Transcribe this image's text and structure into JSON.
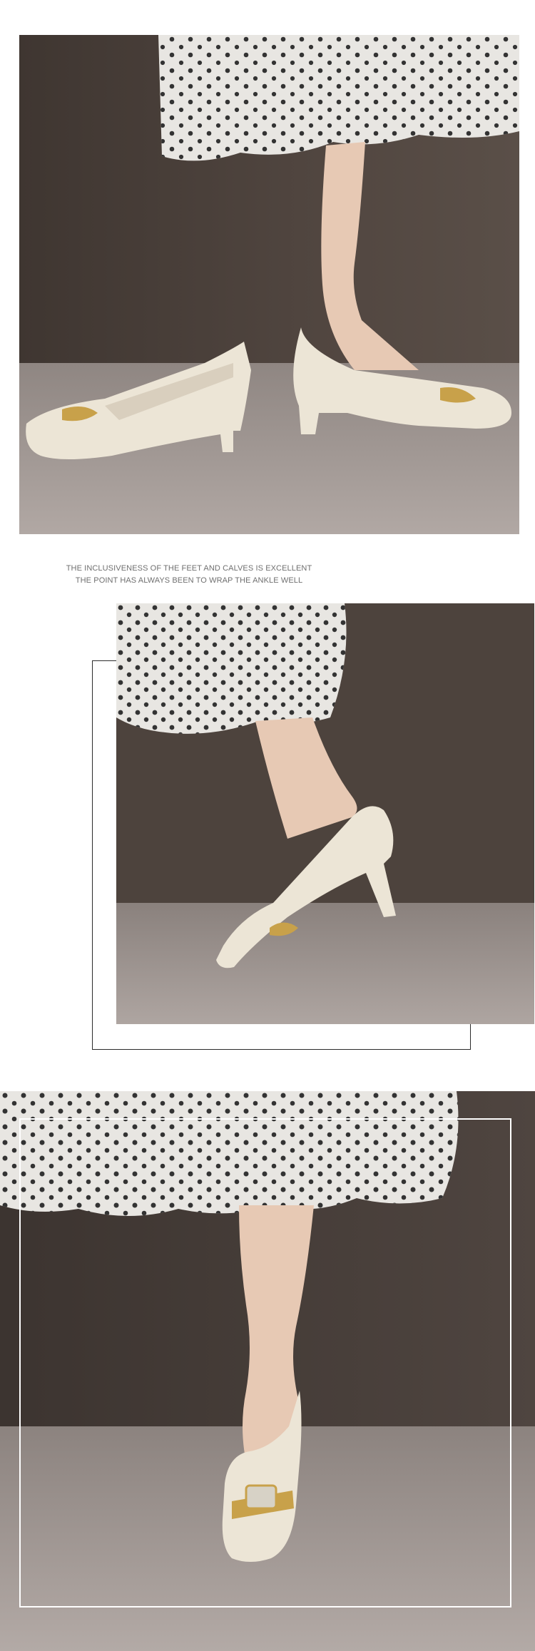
{
  "caption": {
    "line1": "THE INCLUSIVENESS OF THE FEET AND CALVES IS EXCELLENT",
    "line2": "THE POINT HAS ALWAYS BEEN TO WRAP THE ANKLE WELL"
  },
  "colors": {
    "background": "#ffffff",
    "caption_text": "#6f6f6f",
    "frame_dark": "#2b2b2b",
    "frame_light": "#ffffff",
    "wall": "#4a403a",
    "carpet": "#a39a96",
    "shoe": "#ece5d6",
    "skirt": "#e8e6e2",
    "polka_dot": "#1f1f1f",
    "skin": "#e7c9b4",
    "buckle": "#c8a14a"
  },
  "images": [
    {
      "subject": "pair of cream square-toe block-heel pumps with gold buckle, polka-dot tulle skirt"
    },
    {
      "subject": "side view of cream pump on foot, polka-dot tulle skirt"
    },
    {
      "subject": "front view of cream pump on foot with rhinestone buckle, polka-dot tulle skirt"
    }
  ]
}
